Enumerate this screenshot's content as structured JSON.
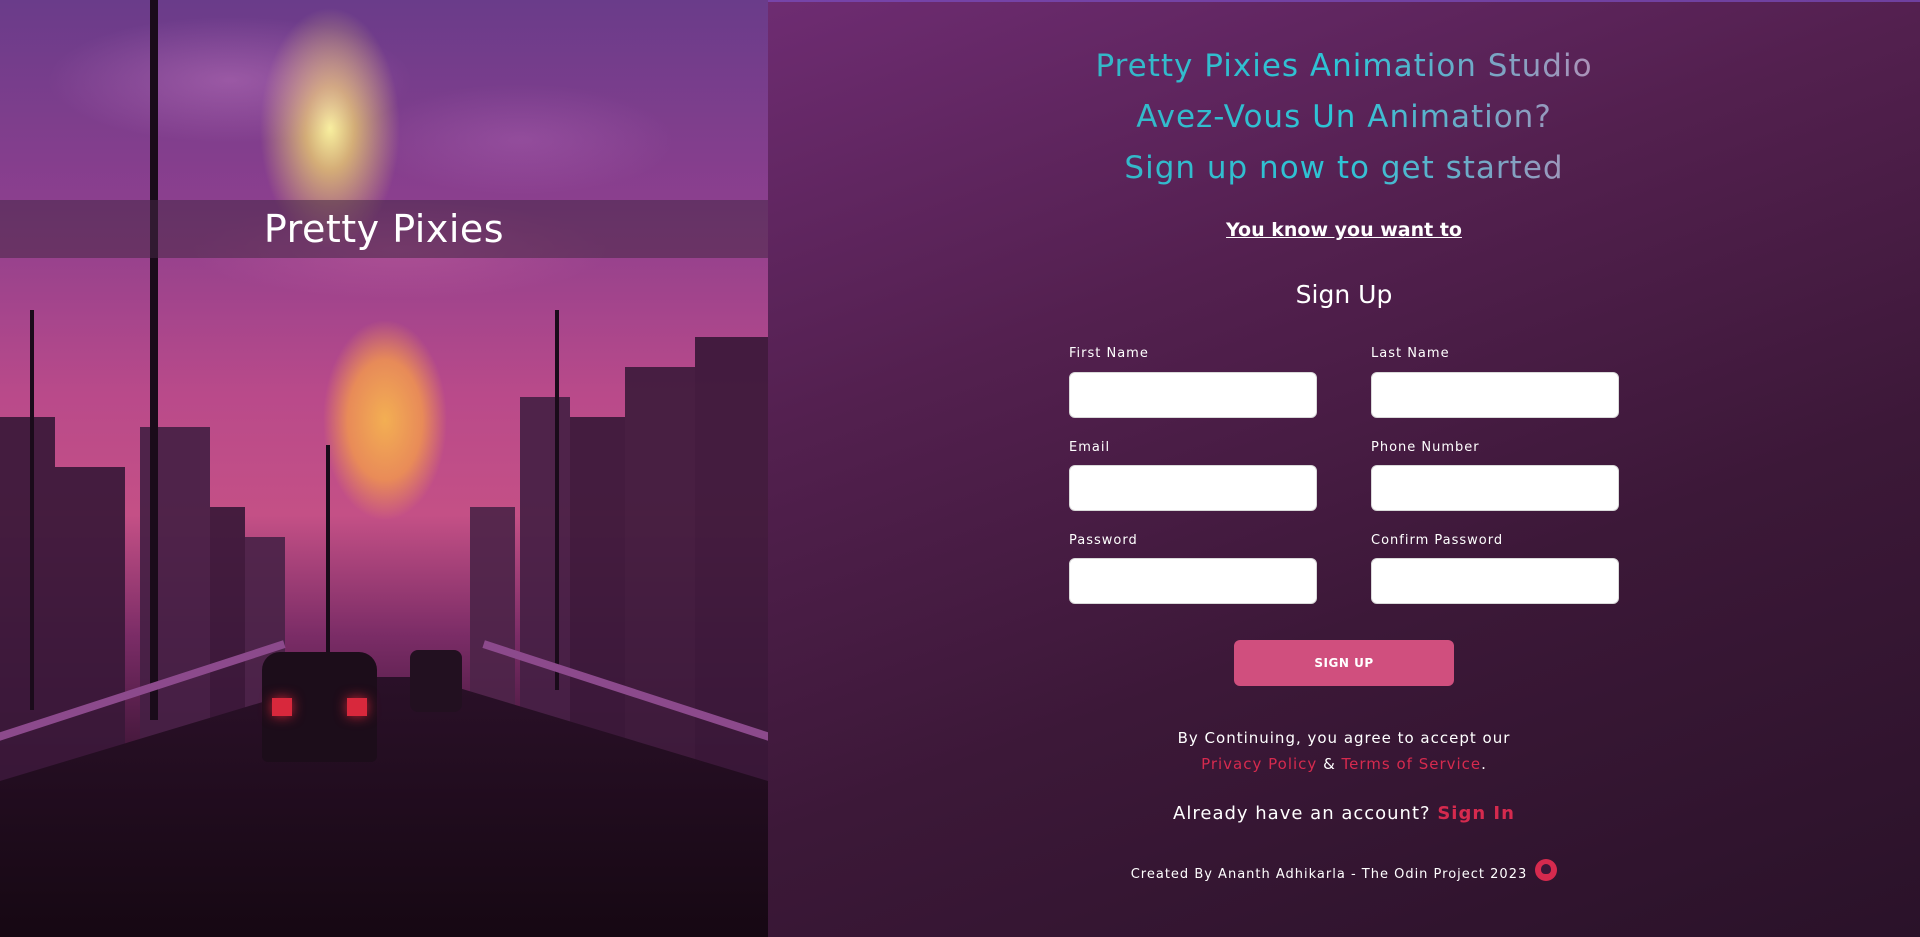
{
  "hero": {
    "brand": "Pretty Pixies"
  },
  "header": {
    "line1": "Pretty Pixies Animation Studio",
    "line2": "Avez-Vous Un Animation?",
    "line3": "Sign up now to get started"
  },
  "tagline": "You know you want to",
  "form": {
    "title": "Sign Up",
    "fields": [
      {
        "label": "First Name",
        "value": "",
        "type": "text"
      },
      {
        "label": "Last Name",
        "value": "",
        "type": "text"
      },
      {
        "label": "Email",
        "value": "",
        "type": "email"
      },
      {
        "label": "Phone Number",
        "value": "",
        "type": "tel"
      },
      {
        "label": "Password",
        "value": "",
        "type": "password"
      },
      {
        "label": "Confirm Password",
        "value": "",
        "type": "password"
      }
    ],
    "submit_label": "SIGN UP"
  },
  "terms": {
    "prefix": "By Continuing, you agree to accept our",
    "privacy": "Privacy Policy",
    "amp": " & ",
    "tos": "Terms of Service",
    "suffix": "."
  },
  "account": {
    "prompt": "Already have an account?",
    "link": "Sign In"
  },
  "footer": {
    "credit": "Created By Ananth Adhikarla - The Odin Project 2023",
    "icon": "github-icon"
  },
  "colors": {
    "accent": "#d04f7e",
    "link": "#d62a4e"
  }
}
